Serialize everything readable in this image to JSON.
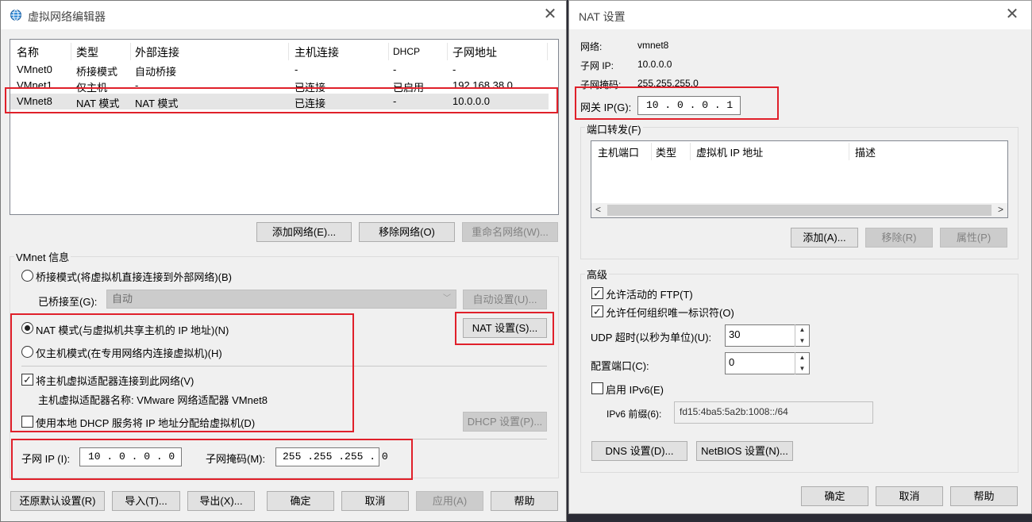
{
  "left": {
    "title": "虚拟网络编辑器",
    "table": {
      "headers": [
        "名称",
        "类型",
        "外部连接",
        "主机连接",
        "DHCP",
        "子网地址"
      ],
      "rows": [
        [
          "VMnet0",
          "桥接模式",
          "自动桥接",
          "-",
          "-",
          "-"
        ],
        [
          "VMnet1",
          "仅主机",
          "-",
          "已连接",
          "已启用",
          "192.168.38.0"
        ],
        [
          "VMnet8",
          "NAT 模式",
          "NAT 模式",
          "已连接",
          "-",
          "10.0.0.0"
        ]
      ]
    },
    "buttons": {
      "add_network": "添加网络(E)...",
      "remove_network": "移除网络(O)",
      "rename_network": "重命名网络(W)..."
    },
    "vmnet_info": {
      "title": "VMnet 信息",
      "bridge_mode": "桥接模式(将虚拟机直接连接到外部网络)(B)",
      "bridged_to_label": "已桥接至(G):",
      "bridged_to_value": "自动",
      "auto_settings": "自动设置(U)...",
      "nat_mode": "NAT 模式(与虚拟机共享主机的 IP 地址)(N)",
      "nat_settings": "NAT 设置(S)...",
      "host_only_mode": "仅主机模式(在专用网络内连接虚拟机)(H)",
      "connect_adapter": "将主机虚拟适配器连接到此网络(V)",
      "adapter_name": "主机虚拟适配器名称: VMware 网络适配器 VMnet8",
      "use_dhcp": "使用本地 DHCP 服务将 IP 地址分配给虚拟机(D)",
      "dhcp_settings": "DHCP 设置(P)...",
      "subnet_ip_label": "子网 IP (I):",
      "subnet_ip": "10 . 0 . 0 . 0",
      "subnet_mask_label": "子网掩码(M):",
      "subnet_mask": "255 .255 .255 . 0"
    },
    "footer": {
      "restore_defaults": "还原默认设置(R)",
      "import": "导入(T)...",
      "export": "导出(X)...",
      "ok": "确定",
      "cancel": "取消",
      "apply": "应用(A)",
      "help": "帮助"
    }
  },
  "right": {
    "title": "NAT 设置",
    "network_label": "网络:",
    "network_value": "vmnet8",
    "subnet_ip_label": "子网 IP:",
    "subnet_ip_value": "10.0.0.0",
    "subnet_mask_label": "子网掩码:",
    "subnet_mask_value": "255.255.255.0",
    "gateway_label": "网关 IP(G):",
    "gateway_value": "10 . 0 . 0 . 1",
    "port_forwarding": {
      "title": "端口转发(F)",
      "headers": [
        "主机端口",
        "类型",
        "虚拟机 IP 地址",
        "描述"
      ],
      "add": "添加(A)...",
      "remove": "移除(R)",
      "properties": "属性(P)"
    },
    "advanced": {
      "title": "高级",
      "allow_ftp": "允许活动的 FTP(T)",
      "allow_oui": "允许任何组织唯一标识符(O)",
      "udp_timeout_label": "UDP 超时(以秒为单位)(U):",
      "udp_timeout_value": "30",
      "config_port_label": "配置端口(C):",
      "config_port_value": "0",
      "enable_ipv6": "启用 IPv6(E)",
      "ipv6_prefix_label": "IPv6 前缀(6):",
      "ipv6_prefix_value": "fd15:4ba5:5a2b:1008::/64",
      "dns_settings": "DNS 设置(D)...",
      "netbios_settings": "NetBIOS 设置(N)..."
    },
    "footer": {
      "ok": "确定",
      "cancel": "取消",
      "help": "帮助"
    }
  }
}
